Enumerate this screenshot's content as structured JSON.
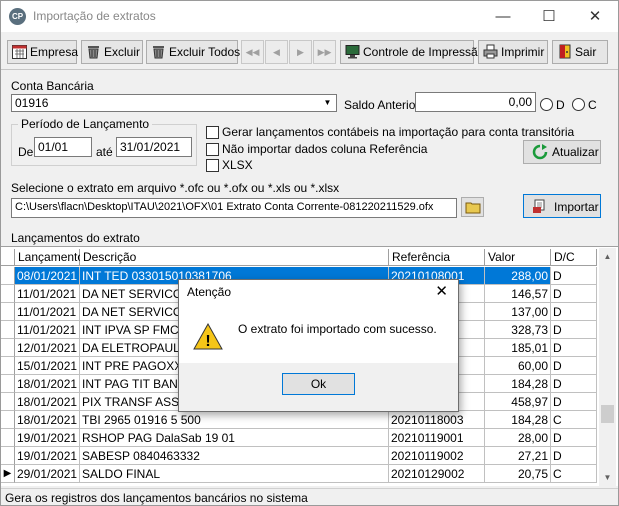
{
  "window": {
    "app_icon_text": "CP",
    "title": "Importação de extratos",
    "minimize_glyph": "—",
    "maximize_glyph": "☐",
    "close_glyph": "✕"
  },
  "toolbar": {
    "empresa": "Empresa",
    "excluir": "Excluir",
    "excluir_todos": "Excluir Todos",
    "nav": [
      "◀◀",
      "◀",
      "▶",
      "▶▶"
    ],
    "controle_impressao": "Controle de Impressão",
    "imprimir": "Imprimir",
    "sair": "Sair"
  },
  "form": {
    "conta_bancaria_label": "Conta Bancária",
    "conta_bancaria_value": "01916",
    "saldo_anterior_label": "Saldo Anterior",
    "saldo_anterior_value": "0,00",
    "radio_d": "D",
    "radio_c": "C",
    "periodo_label": "Período de Lançamento",
    "de_label": "De",
    "de_value": "01/01",
    "ate_label": "até",
    "ate_value": "31/01/2021",
    "chk_contabeis": "Gerar lançamentos contábeis na importação para conta transitória",
    "chk_referencia": "Não importar dados coluna Referência",
    "chk_xlsx": "XLSX",
    "atualizar": "Atualizar",
    "arquivo_label": "Selecione o extrato em arquivo *.ofc ou *.ofx ou *.xls ou *.xlsx",
    "arquivo_value": "C:\\Users\\flacn\\Desktop\\ITAU\\2021\\OFX\\01 Extrato Conta Corrente-081220211529.ofx",
    "importar": "Importar"
  },
  "grid": {
    "label": "Lançamentos do extrato",
    "columns": [
      "Lançamento",
      "Descrição",
      "Referência",
      "Valor",
      "D/C"
    ],
    "rows": [
      {
        "data": "08/01/2021",
        "desc": "INT TED 033015010381706",
        "ref": "20210108001",
        "valor": "288,00",
        "dc": "D",
        "selected": true,
        "current": false
      },
      {
        "data": "11/01/2021",
        "desc": "DA  NET SERVICOS",
        "ref": "2",
        "valor": "146,57",
        "dc": "D",
        "selected": false,
        "current": false
      },
      {
        "data": "11/01/2021",
        "desc": "DA  NET SERVICOS",
        "ref": "3",
        "valor": "137,00",
        "dc": "D",
        "selected": false,
        "current": false
      },
      {
        "data": "11/01/2021",
        "desc": "INT IPVA SP FMC 6",
        "ref": "",
        "valor": "328,73",
        "dc": "D",
        "selected": false,
        "current": false
      },
      {
        "data": "12/01/2021",
        "desc": "DA  ELETROPAULO",
        "ref": "",
        "valor": "185,01",
        "dc": "D",
        "selected": false,
        "current": false
      },
      {
        "data": "15/01/2021",
        "desc": "INT PRE PAGOXXX",
        "ref": "",
        "valor": "60,00",
        "dc": "D",
        "selected": false,
        "current": false
      },
      {
        "data": "18/01/2021",
        "desc": "INT  PAG TIT BANC",
        "ref": "",
        "valor": "184,28",
        "dc": "D",
        "selected": false,
        "current": false
      },
      {
        "data": "18/01/2021",
        "desc": "PIX TRANSF  ASSOC",
        "ref": "2",
        "valor": "458,97",
        "dc": "D",
        "selected": false,
        "current": false
      },
      {
        "data": "18/01/2021",
        "desc": "TBI 2965 01916 5 500",
        "ref": "20210118003",
        "valor": "184,28",
        "dc": "C",
        "selected": false,
        "current": false
      },
      {
        "data": "19/01/2021",
        "desc": "RSHOP PAG DalaSab 19 01",
        "ref": "20210119001",
        "valor": "28,00",
        "dc": "D",
        "selected": false,
        "current": false
      },
      {
        "data": "19/01/2021",
        "desc": "SABESP        0840463332",
        "ref": "20210119002",
        "valor": "27,21",
        "dc": "D",
        "selected": false,
        "current": false
      },
      {
        "data": "29/01/2021",
        "desc": "SALDO FINAL",
        "ref": "20210129002",
        "valor": "20,75",
        "dc": "C",
        "selected": false,
        "current": true
      }
    ]
  },
  "status": "Gera os registros dos lançamentos bancários no sistema",
  "dialog": {
    "title": "Atenção",
    "close_glyph": "✕",
    "warning_glyph": "!",
    "message": "O extrato foi importado com sucesso.",
    "ok": "Ok"
  }
}
